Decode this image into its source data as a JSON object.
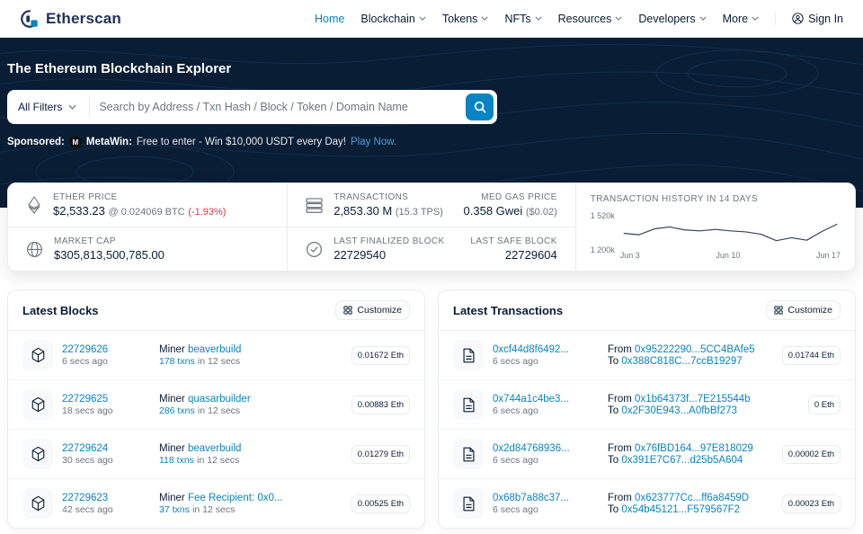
{
  "colors": {
    "accent": "#0784c3",
    "hero_bg": "#091d35",
    "text_dark": "#081d35",
    "text_muted": "#6c757d",
    "danger": "#dc3545",
    "cta_link": "#4da0d9",
    "border": "#e9ecef"
  },
  "header": {
    "brand": "Etherscan",
    "nav": [
      {
        "label": "Home"
      },
      {
        "label": "Blockchain"
      },
      {
        "label": "Tokens"
      },
      {
        "label": "NFTs"
      },
      {
        "label": "Resources"
      },
      {
        "label": "Developers"
      },
      {
        "label": "More"
      }
    ],
    "sign_in": "Sign In"
  },
  "hero": {
    "title": "The Ethereum Blockchain Explorer",
    "filters_label": "All Filters",
    "search_placeholder": "Search by Address / Txn Hash / Block / Token / Domain Name",
    "sponsored_label": "Sponsored:",
    "sponsor_icon_letter": "M",
    "sponsor_name": "MetaWin:",
    "sponsor_text": "Free to enter - Win $10,000 USDT every Day!",
    "sponsor_cta": "Play Now."
  },
  "stats": {
    "ether_price_label": "ETHER PRICE",
    "ether_price": "$2,533.23",
    "ether_price_btc": "@ 0.024069 BTC",
    "ether_price_change": "(-1.93%)",
    "market_cap_label": "MARKET CAP",
    "market_cap": "$305,813,500,785.00",
    "transactions_label": "TRANSACTIONS",
    "transactions": "2,853.30 M",
    "tps": "(15.3 TPS)",
    "med_gas_label": "MED GAS PRICE",
    "med_gas": "0.358 Gwei",
    "med_gas_usd": "($0.02)",
    "last_finalized_label": "LAST FINALIZED BLOCK",
    "last_finalized": "22729540",
    "last_safe_label": "LAST SAFE BLOCK",
    "last_safe": "22729604"
  },
  "chart_data": {
    "type": "line",
    "title": "TRANSACTION HISTORY IN 14 DAYS",
    "ylabel": "",
    "xlabel": "",
    "y_ticks": [
      "1 520k",
      "1 200k"
    ],
    "ylim": [
      1200,
      1520
    ],
    "x_ticks": [
      "Jun 3",
      "Jun 10",
      "Jun 17"
    ],
    "x": [
      "Jun 3",
      "Jun 4",
      "Jun 5",
      "Jun 6",
      "Jun 7",
      "Jun 8",
      "Jun 9",
      "Jun 10",
      "Jun 11",
      "Jun 12",
      "Jun 13",
      "Jun 14",
      "Jun 15",
      "Jun 16",
      "Jun 17"
    ],
    "values": [
      1310,
      1295,
      1355,
      1375,
      1345,
      1335,
      1350,
      1335,
      1325,
      1300,
      1235,
      1265,
      1240,
      1330,
      1405
    ],
    "legend": [],
    "grid": false
  },
  "blocks_panel": {
    "title": "Latest Blocks",
    "customize": "Customize",
    "rows": [
      {
        "number": "22729626",
        "age": "6 secs ago",
        "miner_label": "Miner",
        "miner": "beaverbuild",
        "txns": "178 txns",
        "in_time": "in 12 secs",
        "reward": "0.01672 Eth"
      },
      {
        "number": "22729625",
        "age": "18 secs ago",
        "miner_label": "Miner",
        "miner": "quasarbuilder",
        "txns": "286 txns",
        "in_time": "in 12 secs",
        "reward": "0.00883 Eth"
      },
      {
        "number": "22729624",
        "age": "30 secs ago",
        "miner_label": "Miner",
        "miner": "beaverbuild",
        "txns": "118 txns",
        "in_time": "in 12 secs",
        "reward": "0.01279 Eth"
      },
      {
        "number": "22729623",
        "age": "42 secs ago",
        "miner_label": "Miner",
        "miner": "Fee Recipient: 0x0...",
        "txns": "37 txns",
        "in_time": "in 12 secs",
        "reward": "0.00525 Eth"
      }
    ]
  },
  "txns_panel": {
    "title": "Latest Transactions",
    "customize": "Customize",
    "rows": [
      {
        "hash": "0xcf44d8f6492...",
        "age": "6 secs ago",
        "from_label": "From",
        "from": "0x95222290...5CC4BAfe5",
        "to_label": "To",
        "to": "0x388C818C...7ccB19297",
        "value": "0.01744 Eth"
      },
      {
        "hash": "0x744a1c4be3...",
        "age": "6 secs ago",
        "from_label": "From",
        "from": "0x1b64373f...7E215544b",
        "to_label": "To",
        "to": "0x2F30E943...A0fbBf273",
        "value": "0 Eth"
      },
      {
        "hash": "0x2d84768936...",
        "age": "6 secs ago",
        "from_label": "From",
        "from": "0x76fBD164...97E818029",
        "to_label": "To",
        "to": "0x391E7C67...d25b5A604",
        "value": "0.00002 Eth"
      },
      {
        "hash": "0x68b7a88c37...",
        "age": "6 secs ago",
        "from_label": "From",
        "from": "0x623777Cc...ff6a8459D",
        "to_label": "To",
        "to": "0x54b45121...F579567F2",
        "value": "0.00023 Eth"
      }
    ]
  }
}
